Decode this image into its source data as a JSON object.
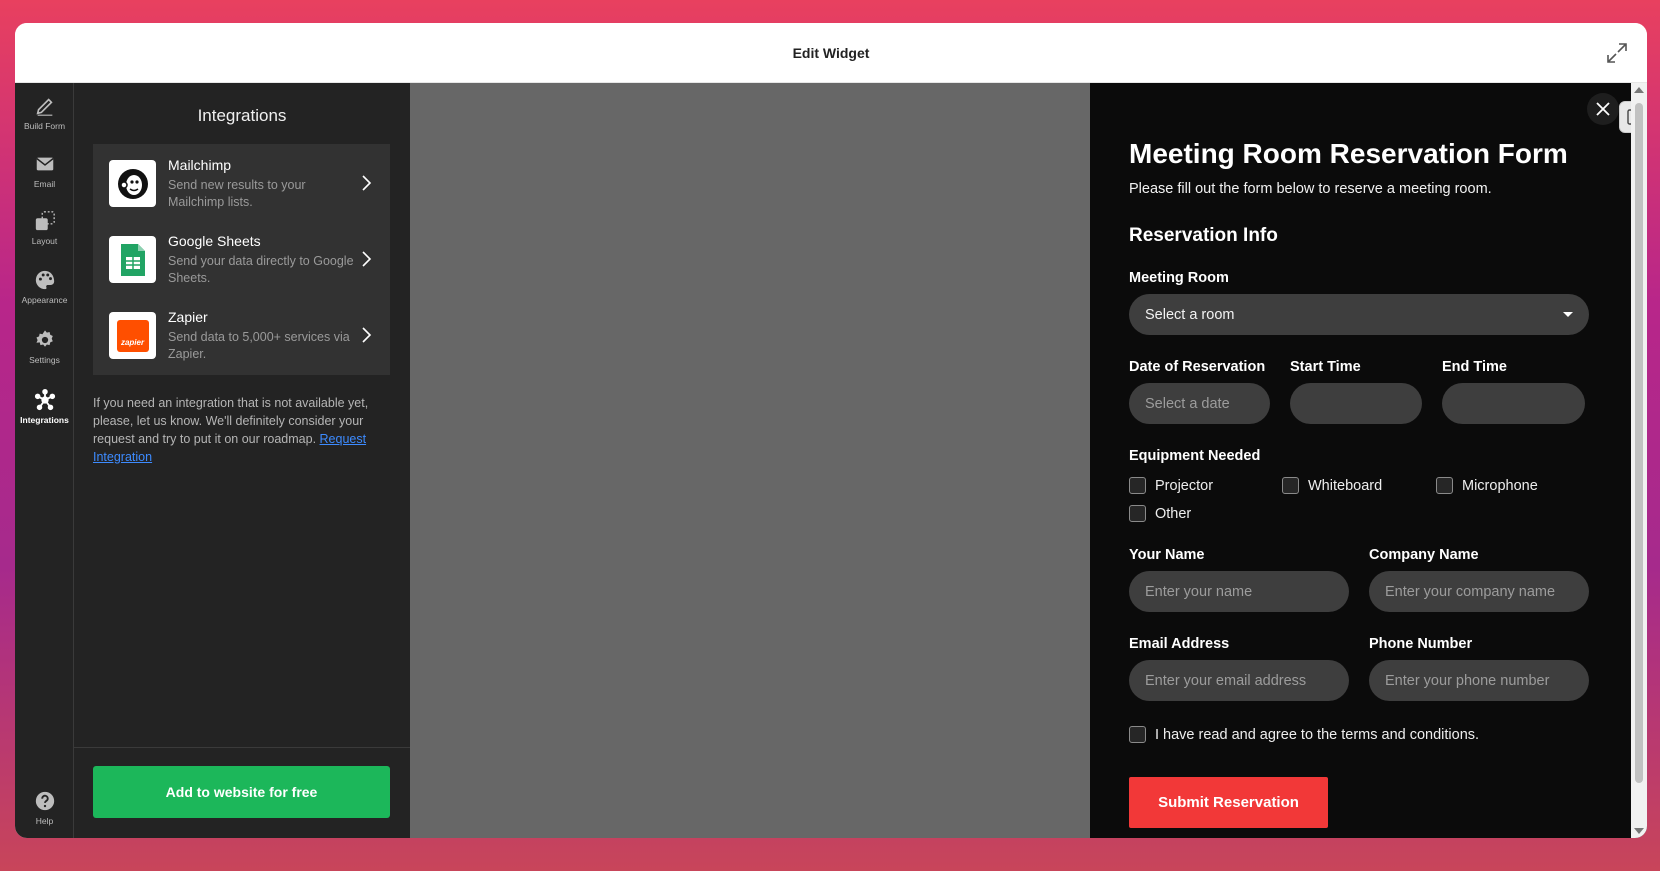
{
  "window": {
    "title": "Edit Widget"
  },
  "sidebar": {
    "items": [
      {
        "label": "Build Form",
        "icon": "pencil-icon"
      },
      {
        "label": "Email",
        "icon": "mail-icon"
      },
      {
        "label": "Layout",
        "icon": "layout-icon"
      },
      {
        "label": "Appearance",
        "icon": "palette-icon"
      },
      {
        "label": "Settings",
        "icon": "gear-icon"
      },
      {
        "label": "Integrations",
        "icon": "integrations-icon",
        "active": true
      }
    ],
    "help": {
      "label": "Help",
      "icon": "help-icon"
    }
  },
  "panel": {
    "title": "Integrations",
    "integrations": [
      {
        "name": "Mailchimp",
        "description": "Send new results to your Mailchimp lists.",
        "icon": "mailchimp-logo"
      },
      {
        "name": "Google Sheets",
        "description": "Send your data directly to Google Sheets.",
        "icon": "google-sheets-logo"
      },
      {
        "name": "Zapier",
        "description": "Send data to 5,000+ services via Zapier.",
        "icon": "zapier-logo",
        "logo_text": "zapier"
      }
    ],
    "note": "If you need an integration that is not available yet, please, let us know. We'll definitely consider your request and try to put it on our roadmap. ",
    "note_link": "Request Integration",
    "add_button": "Add to website for free"
  },
  "form": {
    "title": "Meeting Room Reservation Form",
    "subtitle": "Please fill out the form below to reserve a meeting room.",
    "section": "Reservation Info",
    "meeting_room": {
      "label": "Meeting Room",
      "value": "Select a room"
    },
    "date": {
      "label": "Date of Reservation",
      "placeholder": "Select a date"
    },
    "start_time": {
      "label": "Start Time",
      "value": ""
    },
    "end_time": {
      "label": "End Time",
      "value": ""
    },
    "equipment": {
      "label": "Equipment Needed",
      "options": [
        "Projector",
        "Whiteboard",
        "Microphone",
        "Other"
      ]
    },
    "your_name": {
      "label": "Your Name",
      "placeholder": "Enter your name"
    },
    "company_name": {
      "label": "Company Name",
      "placeholder": "Enter your company name"
    },
    "email": {
      "label": "Email Address",
      "placeholder": "Enter your email address"
    },
    "phone": {
      "label": "Phone Number",
      "placeholder": "Enter your phone number"
    },
    "terms": "I have read and agree to the terms and conditions.",
    "submit": "Submit Reservation"
  },
  "colors": {
    "accent_green": "#1cb75a",
    "submit_red": "#f23838",
    "panel_bg": "#232323",
    "form_bg": "#0b0b0b",
    "preview_bg": "#676767"
  }
}
